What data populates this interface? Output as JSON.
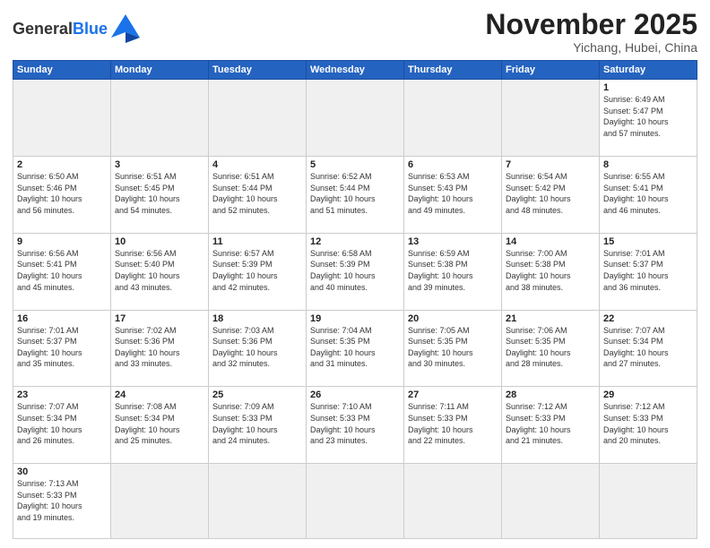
{
  "header": {
    "logo_general": "General",
    "logo_blue": "Blue",
    "month_title": "November 2025",
    "location": "Yichang, Hubei, China"
  },
  "weekdays": [
    "Sunday",
    "Monday",
    "Tuesday",
    "Wednesday",
    "Thursday",
    "Friday",
    "Saturday"
  ],
  "weeks": [
    [
      {
        "day": "",
        "info": "",
        "empty": true
      },
      {
        "day": "",
        "info": "",
        "empty": true
      },
      {
        "day": "",
        "info": "",
        "empty": true
      },
      {
        "day": "",
        "info": "",
        "empty": true
      },
      {
        "day": "",
        "info": "",
        "empty": true
      },
      {
        "day": "",
        "info": "",
        "empty": true
      },
      {
        "day": "1",
        "info": "Sunrise: 6:49 AM\nSunset: 5:47 PM\nDaylight: 10 hours\nand 57 minutes."
      }
    ],
    [
      {
        "day": "2",
        "info": "Sunrise: 6:50 AM\nSunset: 5:46 PM\nDaylight: 10 hours\nand 56 minutes."
      },
      {
        "day": "3",
        "info": "Sunrise: 6:51 AM\nSunset: 5:45 PM\nDaylight: 10 hours\nand 54 minutes."
      },
      {
        "day": "4",
        "info": "Sunrise: 6:51 AM\nSunset: 5:44 PM\nDaylight: 10 hours\nand 52 minutes."
      },
      {
        "day": "5",
        "info": "Sunrise: 6:52 AM\nSunset: 5:44 PM\nDaylight: 10 hours\nand 51 minutes."
      },
      {
        "day": "6",
        "info": "Sunrise: 6:53 AM\nSunset: 5:43 PM\nDaylight: 10 hours\nand 49 minutes."
      },
      {
        "day": "7",
        "info": "Sunrise: 6:54 AM\nSunset: 5:42 PM\nDaylight: 10 hours\nand 48 minutes."
      },
      {
        "day": "8",
        "info": "Sunrise: 6:55 AM\nSunset: 5:41 PM\nDaylight: 10 hours\nand 46 minutes."
      }
    ],
    [
      {
        "day": "9",
        "info": "Sunrise: 6:56 AM\nSunset: 5:41 PM\nDaylight: 10 hours\nand 45 minutes."
      },
      {
        "day": "10",
        "info": "Sunrise: 6:56 AM\nSunset: 5:40 PM\nDaylight: 10 hours\nand 43 minutes."
      },
      {
        "day": "11",
        "info": "Sunrise: 6:57 AM\nSunset: 5:39 PM\nDaylight: 10 hours\nand 42 minutes."
      },
      {
        "day": "12",
        "info": "Sunrise: 6:58 AM\nSunset: 5:39 PM\nDaylight: 10 hours\nand 40 minutes."
      },
      {
        "day": "13",
        "info": "Sunrise: 6:59 AM\nSunset: 5:38 PM\nDaylight: 10 hours\nand 39 minutes."
      },
      {
        "day": "14",
        "info": "Sunrise: 7:00 AM\nSunset: 5:38 PM\nDaylight: 10 hours\nand 38 minutes."
      },
      {
        "day": "15",
        "info": "Sunrise: 7:01 AM\nSunset: 5:37 PM\nDaylight: 10 hours\nand 36 minutes."
      }
    ],
    [
      {
        "day": "16",
        "info": "Sunrise: 7:01 AM\nSunset: 5:37 PM\nDaylight: 10 hours\nand 35 minutes."
      },
      {
        "day": "17",
        "info": "Sunrise: 7:02 AM\nSunset: 5:36 PM\nDaylight: 10 hours\nand 33 minutes."
      },
      {
        "day": "18",
        "info": "Sunrise: 7:03 AM\nSunset: 5:36 PM\nDaylight: 10 hours\nand 32 minutes."
      },
      {
        "day": "19",
        "info": "Sunrise: 7:04 AM\nSunset: 5:35 PM\nDaylight: 10 hours\nand 31 minutes."
      },
      {
        "day": "20",
        "info": "Sunrise: 7:05 AM\nSunset: 5:35 PM\nDaylight: 10 hours\nand 30 minutes."
      },
      {
        "day": "21",
        "info": "Sunrise: 7:06 AM\nSunset: 5:35 PM\nDaylight: 10 hours\nand 28 minutes."
      },
      {
        "day": "22",
        "info": "Sunrise: 7:07 AM\nSunset: 5:34 PM\nDaylight: 10 hours\nand 27 minutes."
      }
    ],
    [
      {
        "day": "23",
        "info": "Sunrise: 7:07 AM\nSunset: 5:34 PM\nDaylight: 10 hours\nand 26 minutes."
      },
      {
        "day": "24",
        "info": "Sunrise: 7:08 AM\nSunset: 5:34 PM\nDaylight: 10 hours\nand 25 minutes."
      },
      {
        "day": "25",
        "info": "Sunrise: 7:09 AM\nSunset: 5:33 PM\nDaylight: 10 hours\nand 24 minutes."
      },
      {
        "day": "26",
        "info": "Sunrise: 7:10 AM\nSunset: 5:33 PM\nDaylight: 10 hours\nand 23 minutes."
      },
      {
        "day": "27",
        "info": "Sunrise: 7:11 AM\nSunset: 5:33 PM\nDaylight: 10 hours\nand 22 minutes."
      },
      {
        "day": "28",
        "info": "Sunrise: 7:12 AM\nSunset: 5:33 PM\nDaylight: 10 hours\nand 21 minutes."
      },
      {
        "day": "29",
        "info": "Sunrise: 7:12 AM\nSunset: 5:33 PM\nDaylight: 10 hours\nand 20 minutes."
      }
    ],
    [
      {
        "day": "30",
        "info": "Sunrise: 7:13 AM\nSunset: 5:33 PM\nDaylight: 10 hours\nand 19 minutes."
      },
      {
        "day": "",
        "info": "",
        "empty": true
      },
      {
        "day": "",
        "info": "",
        "empty": true
      },
      {
        "day": "",
        "info": "",
        "empty": true
      },
      {
        "day": "",
        "info": "",
        "empty": true
      },
      {
        "day": "",
        "info": "",
        "empty": true
      },
      {
        "day": "",
        "info": "",
        "empty": true
      }
    ]
  ]
}
